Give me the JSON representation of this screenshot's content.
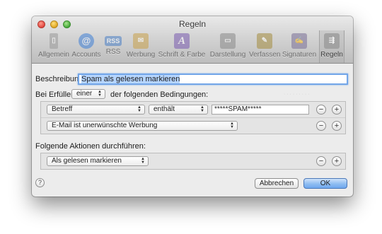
{
  "window": {
    "title": "Regeln"
  },
  "toolbar": {
    "items": [
      {
        "label": "Allgemein",
        "icon": "switch-icon",
        "color": "#9a9a9a"
      },
      {
        "label": "Accounts",
        "icon": "at-icon",
        "color": "#3e7fd6"
      },
      {
        "label": "RSS",
        "icon": "rss-icon",
        "color": "#4a7fc6"
      },
      {
        "label": "Werbung",
        "icon": "envelope-icon",
        "color": "#c9a14a"
      },
      {
        "label": "Schrift & Farbe",
        "icon": "font-icon",
        "color": "#7a5bb0"
      },
      {
        "label": "Darstellung",
        "icon": "display-icon",
        "color": "#8a8a8a"
      },
      {
        "label": "Verfassen",
        "icon": "pencil-icon",
        "color": "#a48c3e"
      },
      {
        "label": "Signaturen",
        "icon": "signature-icon",
        "color": "#7a6f97"
      },
      {
        "label": "Regeln",
        "icon": "rules-icon",
        "color": "#9b9b9b"
      }
    ],
    "active": "Regeln"
  },
  "form": {
    "description_label": "Beschreibung:",
    "description_value": "Spam als gelesen markieren",
    "if_label": "Bei Erfüllen",
    "quantifier": "einer",
    "conditions_suffix": "der folgenden Bedingungen:",
    "conditions": [
      {
        "field": "Betreff",
        "operator": "enthält",
        "value": "*****SPAM*****"
      },
      {
        "field": "E-Mail ist unerwünschte Werbung"
      }
    ],
    "actions_label": "Folgende Aktionen durchführen:",
    "actions": [
      {
        "action": "Als gelesen markieren"
      }
    ]
  },
  "buttons": {
    "help": "?",
    "cancel": "Abbrechen",
    "ok": "OK",
    "remove": "−",
    "add": "+"
  }
}
